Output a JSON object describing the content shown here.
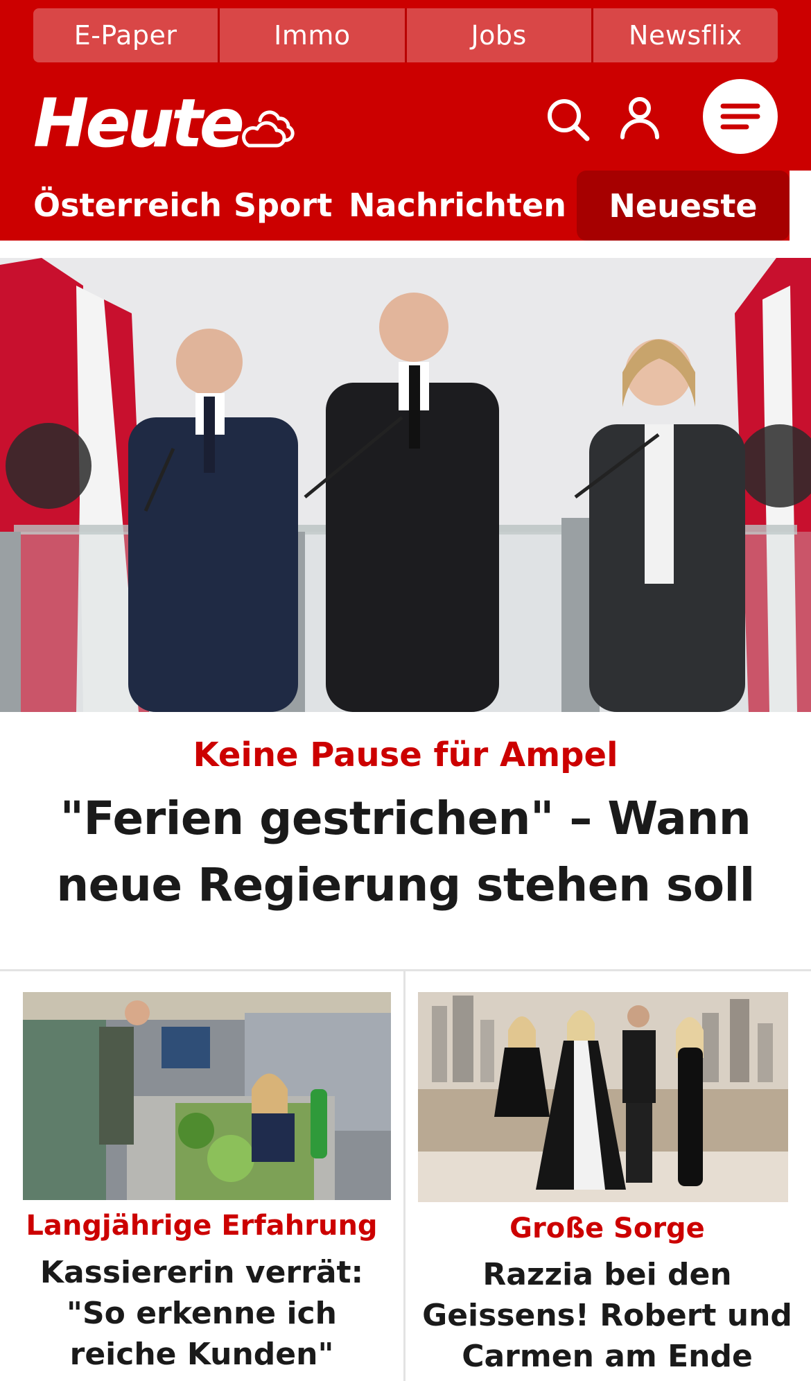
{
  "utility_nav": {
    "items": [
      {
        "label": "E-Paper"
      },
      {
        "label": "Immo"
      },
      {
        "label": "Jobs"
      },
      {
        "label": "Newsflix"
      }
    ]
  },
  "brand": {
    "logo_text": "Heute",
    "icons": {
      "weather": "weather-cloud-icon",
      "search": "search-icon",
      "account": "user-icon",
      "menu": "hamburger-menu-icon"
    }
  },
  "main_nav": {
    "items": [
      {
        "label": "Österreich"
      },
      {
        "label": "Sport"
      },
      {
        "label": "Nachrichten"
      }
    ],
    "active_tab": {
      "label": "Neueste"
    }
  },
  "hero": {
    "kicker": "Keine Pause für Ampel",
    "headline": "\"Ferien gestrichen\" – Wann neue Regierung stehen soll"
  },
  "cards": [
    {
      "kicker": "Langjährige Erfahrung",
      "headline": "Kassiererin verrät: \"So erkenne ich reiche Kunden\""
    },
    {
      "kicker": "Große Sorge",
      "headline": "Razzia bei den Geissens! Robert und Carmen am Ende"
    }
  ],
  "colors": {
    "brand_red": "#cc0000",
    "active_tab": "#a60000",
    "utility_button": "#d94747",
    "headline_text": "#1a1a1a"
  }
}
